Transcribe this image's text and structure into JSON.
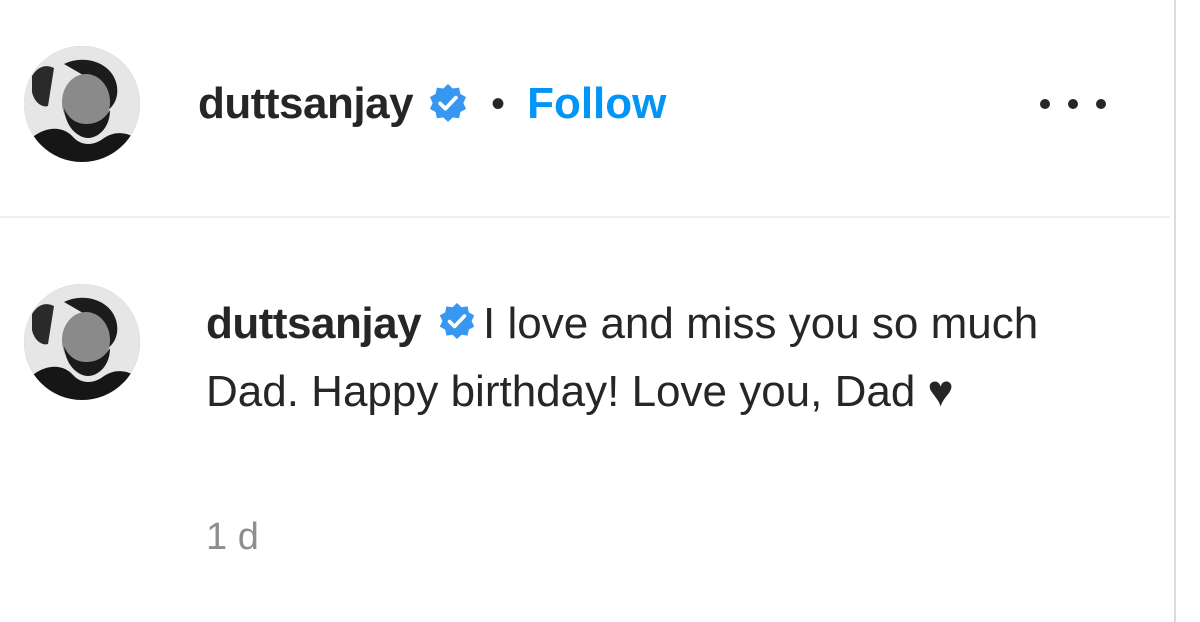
{
  "header": {
    "username": "duttsanjay",
    "separator": "•",
    "follow_label": "Follow",
    "avatar_icon": "profile-photo",
    "verified_icon": "verified-badge-icon",
    "more_icon": "more-options-icon"
  },
  "comment": {
    "username": "duttsanjay",
    "text": "I love and miss you so much Dad. Happy birthday! Love you, Dad ♥",
    "timestamp": "1 d"
  },
  "colors": {
    "accent": "#0095f6",
    "text": "#262626",
    "muted": "#8e8e8e",
    "divider": "#efefef"
  }
}
